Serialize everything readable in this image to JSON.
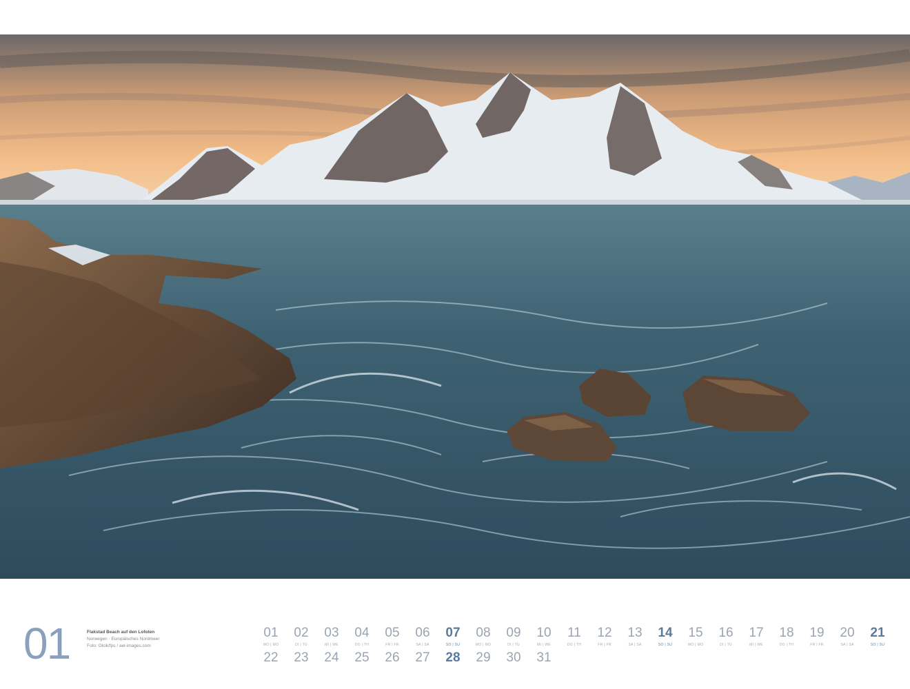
{
  "page": {
    "month_number": "01",
    "caption": {
      "title": "Flakstad Beach auf den Lofoten",
      "location": "Norwegen · Europäisches Nordmeer",
      "credit": "Foto: Olcik/fps / ael-images.com"
    }
  },
  "photo": {
    "description_icon": "landscape-photo",
    "colors": {
      "sky_top": "#6e6b6a",
      "sky_glow": "#f0b37a",
      "snow": "#e7ecf1",
      "rock": "#4f4744",
      "sea": "#3f5f70",
      "foam": "#c9dbe6",
      "shore_rock": "#6b4c34"
    }
  },
  "calendar": {
    "sunday_color": "#5b7a9e",
    "row1": [
      {
        "n": "01",
        "wd": "MO | MO",
        "sun": false
      },
      {
        "n": "02",
        "wd": "DI | TU",
        "sun": false
      },
      {
        "n": "03",
        "wd": "MI | WE",
        "sun": false
      },
      {
        "n": "04",
        "wd": "DO | TH",
        "sun": false
      },
      {
        "n": "05",
        "wd": "FR | FR",
        "sun": false
      },
      {
        "n": "06",
        "wd": "SA | SA",
        "sun": false
      },
      {
        "n": "07",
        "wd": "SO | SU",
        "sun": true
      },
      {
        "n": "08",
        "wd": "MO | MO",
        "sun": false
      },
      {
        "n": "09",
        "wd": "DI | TU",
        "sun": false
      },
      {
        "n": "10",
        "wd": "MI | WE",
        "sun": false
      },
      {
        "n": "11",
        "wd": "DO | TH",
        "sun": false
      },
      {
        "n": "12",
        "wd": "FR | FR",
        "sun": false
      },
      {
        "n": "13",
        "wd": "SA | SA",
        "sun": false
      },
      {
        "n": "14",
        "wd": "SO | SU",
        "sun": true
      },
      {
        "n": "15",
        "wd": "MO | MO",
        "sun": false
      },
      {
        "n": "16",
        "wd": "DI | TU",
        "sun": false
      },
      {
        "n": "17",
        "wd": "MI | WE",
        "sun": false
      },
      {
        "n": "18",
        "wd": "DO | TH",
        "sun": false
      },
      {
        "n": "19",
        "wd": "FR | FR",
        "sun": false
      },
      {
        "n": "20",
        "wd": "SA | SA",
        "sun": false
      },
      {
        "n": "21",
        "wd": "SO | SU",
        "sun": true
      }
    ],
    "row2": [
      {
        "n": "22",
        "sun": false
      },
      {
        "n": "23",
        "sun": false
      },
      {
        "n": "24",
        "sun": false
      },
      {
        "n": "25",
        "sun": false
      },
      {
        "n": "26",
        "sun": false
      },
      {
        "n": "27",
        "sun": false
      },
      {
        "n": "28",
        "sun": true
      },
      {
        "n": "29",
        "sun": false
      },
      {
        "n": "30",
        "sun": false
      },
      {
        "n": "31",
        "sun": false
      }
    ]
  }
}
